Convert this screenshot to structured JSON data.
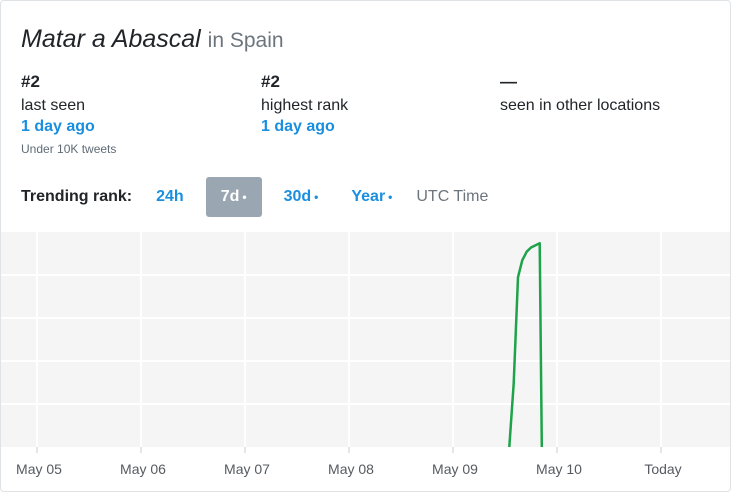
{
  "title": {
    "topic": "Matar a Abascal",
    "location": "in Spain"
  },
  "stats": {
    "last_seen": {
      "rank": "#2",
      "label": "last seen",
      "ago": "1 day ago",
      "note": "Under 10K tweets"
    },
    "highest": {
      "rank": "#2",
      "label": "highest rank",
      "ago": "1 day ago"
    },
    "other": {
      "rank": "—",
      "label": "seen in other locations"
    }
  },
  "range": {
    "label": "Trending rank:",
    "buttons": [
      "24h",
      "7d",
      "30d",
      "Year"
    ],
    "active": "7d",
    "dot": "•",
    "timezone": "UTC Time"
  },
  "colors": {
    "accent": "#1a8fe0",
    "line": "#1fa34a",
    "plot_bg": "#f5f5f5",
    "active_btn": "#9aa6b1"
  },
  "chart_data": {
    "type": "line",
    "x_ticks": [
      "May 05",
      "May 06",
      "May 07",
      "May 08",
      "May 09",
      "May 10",
      "Today"
    ],
    "xlim": [
      "May 05 00:00",
      "May 11 00:00"
    ],
    "ylim": [
      1,
      50
    ],
    "y_reversed": true,
    "grid": true,
    "series": [
      {
        "x": [
          "May 09 13:00",
          "May 09 14:00",
          "May 09 15:00",
          "May 09 16:00",
          "May 09 17:00",
          "May 09 18:00",
          "May 09 20:00",
          "May 09 20:30"
        ],
        "y": [
          50,
          35,
          10,
          6,
          4,
          3,
          2,
          50
        ]
      }
    ]
  }
}
